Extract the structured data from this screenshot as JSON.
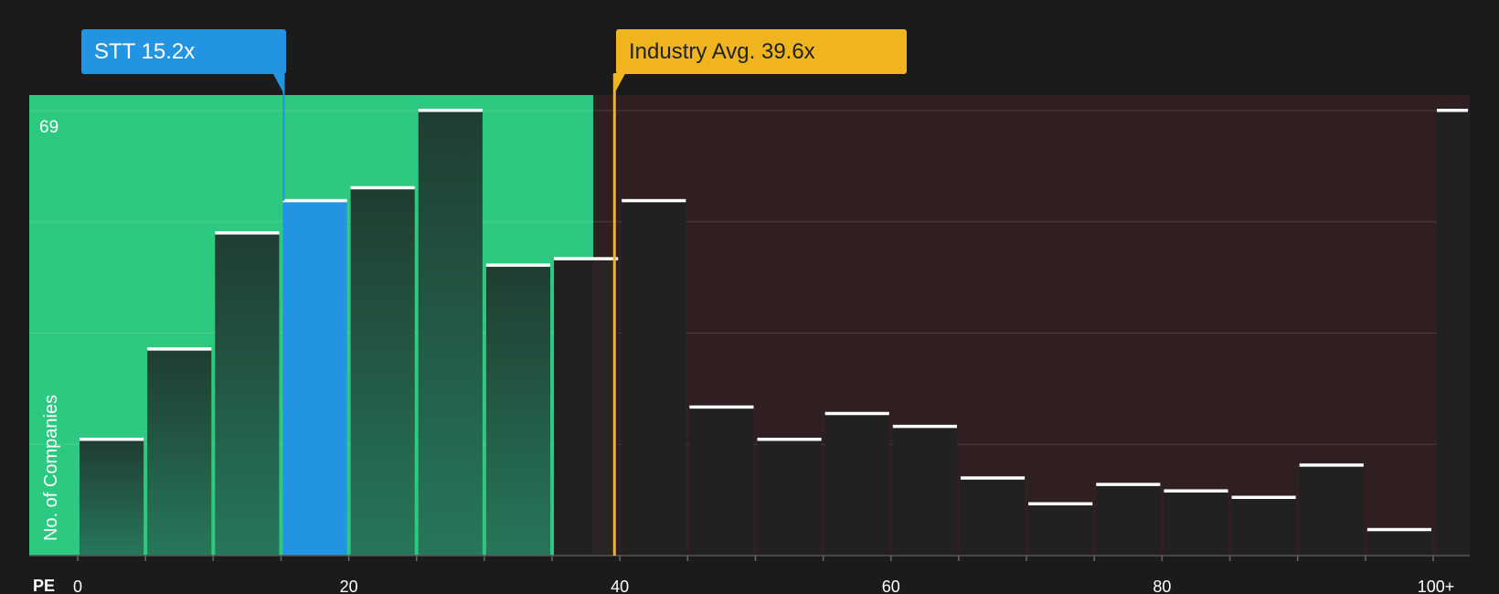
{
  "chart_data": {
    "type": "bar",
    "subject": {
      "label": "STT 15.2x",
      "value": 15.2,
      "color": "#2394e1"
    },
    "industry": {
      "label": "Industry Avg. 39.6x",
      "value": 39.6,
      "color": "#efb41e"
    },
    "bin_width": 5,
    "bins": [
      {
        "start": 0,
        "count": 18
      },
      {
        "start": 5,
        "count": 32
      },
      {
        "start": 10,
        "count": 50
      },
      {
        "start": 15,
        "count": 55
      },
      {
        "start": 20,
        "count": 57
      },
      {
        "start": 25,
        "count": 69
      },
      {
        "start": 30,
        "count": 45
      },
      {
        "start": 35,
        "count": 46
      },
      {
        "start": 40,
        "count": 55
      },
      {
        "start": 45,
        "count": 23
      },
      {
        "start": 50,
        "count": 18
      },
      {
        "start": 55,
        "count": 22
      },
      {
        "start": 60,
        "count": 20
      },
      {
        "start": 65,
        "count": 12
      },
      {
        "start": 70,
        "count": 8
      },
      {
        "start": 75,
        "count": 11
      },
      {
        "start": 80,
        "count": 10
      },
      {
        "start": 85,
        "count": 9
      },
      {
        "start": 90,
        "count": 14
      },
      {
        "start": 95,
        "count": 4
      },
      {
        "start": 100,
        "count": 69
      }
    ],
    "highlight_bin_start": 15,
    "undervalued_until": 38,
    "xlim": [
      0,
      100
    ],
    "ylim": [
      0,
      69
    ],
    "x_ticks": [
      "0",
      "20",
      "40",
      "60",
      "80",
      "100+"
    ],
    "x_tick_values": [
      0,
      20,
      40,
      60,
      80,
      100
    ],
    "y_max_label": "69",
    "ylabel": "No. of Companies",
    "xlabel": "PE",
    "colors": {
      "undervalued_zone": "#2ec981",
      "overvalued_zone": "#2f1f21",
      "bar_in_zone": "#1f4a36",
      "bar_outside_zone": "#222122",
      "bar_top": "#ffffff"
    }
  }
}
